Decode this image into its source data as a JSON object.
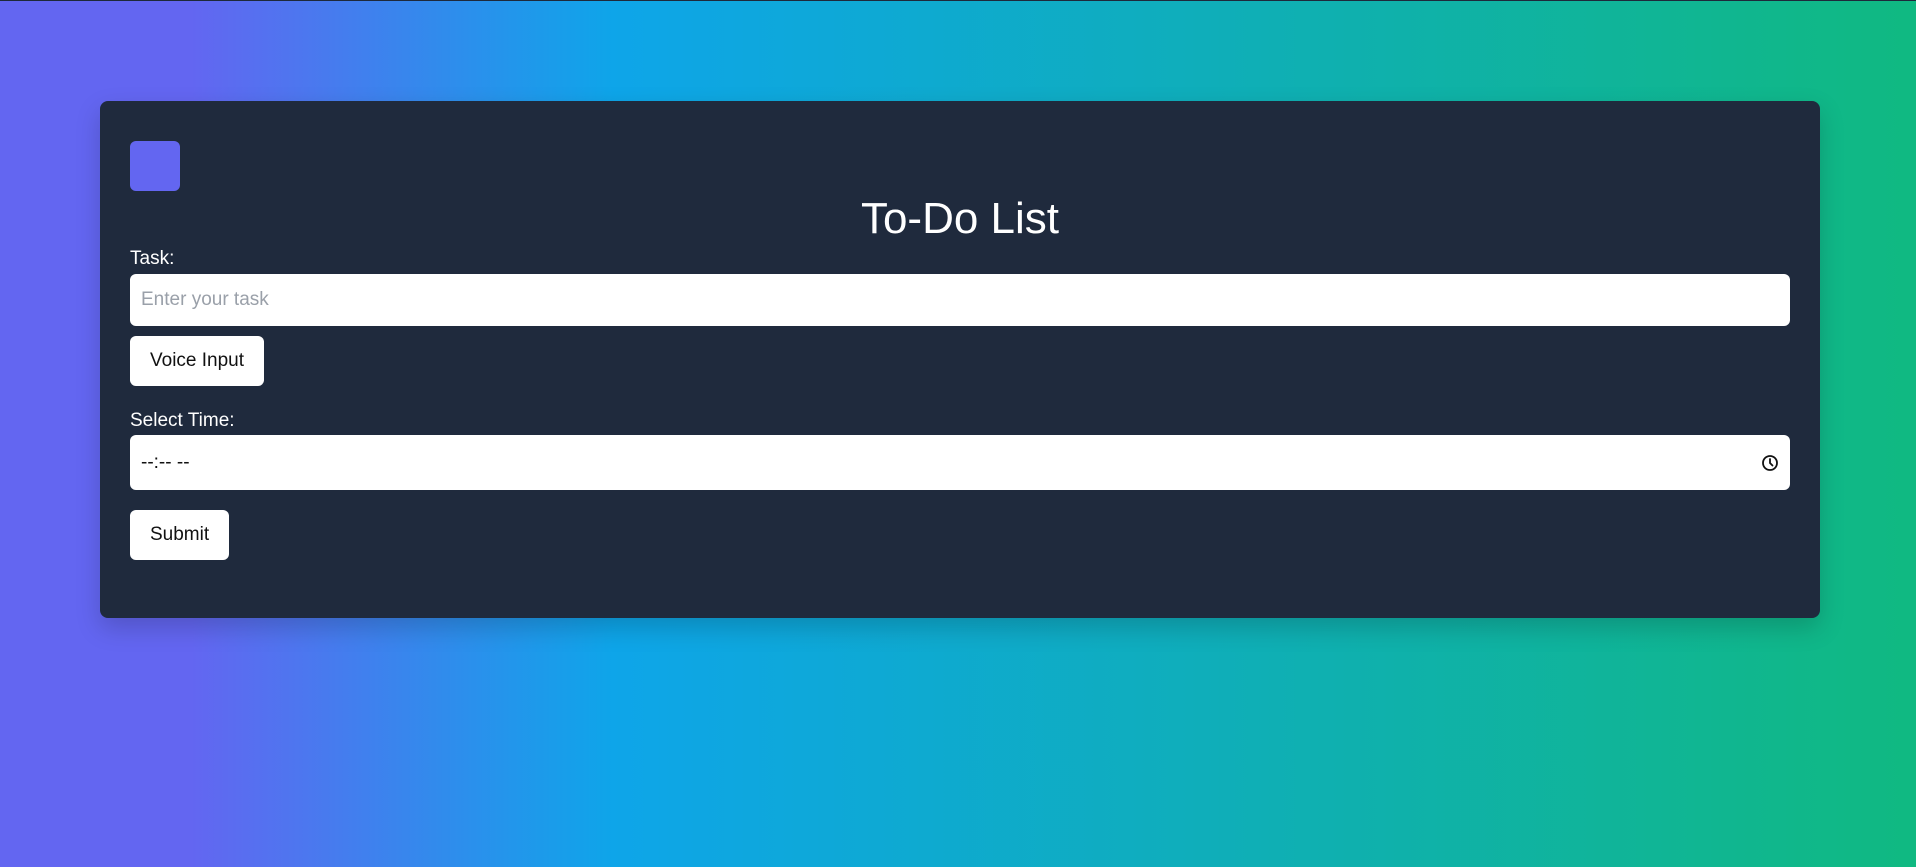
{
  "header": {
    "title": "To-Do List"
  },
  "form": {
    "task_label": "Task:",
    "task_placeholder": "Enter your task",
    "task_value": "",
    "voice_button_label": "Voice Input",
    "time_label": "Select Time:",
    "time_value": "--:-- --",
    "submit_label": "Submit"
  },
  "icons": {
    "logo": "app-logo-square",
    "time_picker": "clock-icon"
  },
  "colors": {
    "background_gradient": [
      "#6366f1",
      "#0ea5e9",
      "#10b981"
    ],
    "card_background": "#1f2a3d",
    "logo": "#6366f1",
    "button_background": "#ffffff"
  }
}
